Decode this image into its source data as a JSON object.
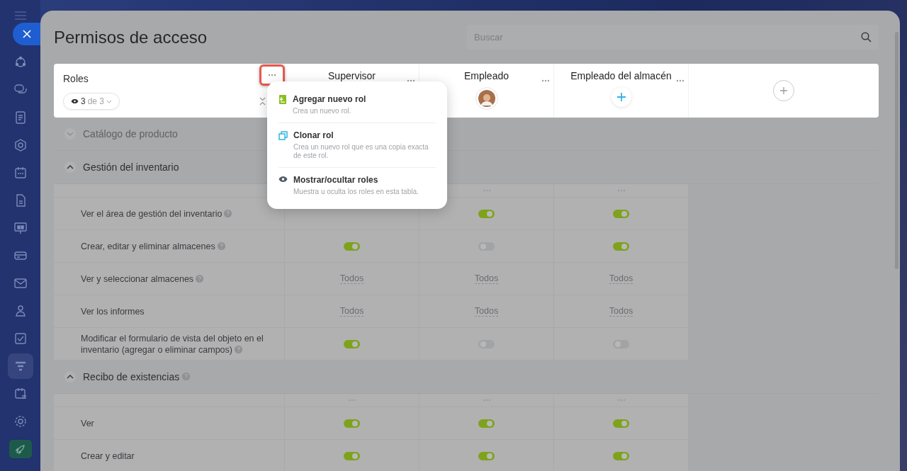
{
  "title": "Permisos de acceso",
  "search": {
    "placeholder": "Buscar"
  },
  "roles_header": {
    "label": "Roles",
    "filter_count": "3",
    "filter_total": "de 3",
    "menu_highlighted": true
  },
  "roles": [
    {
      "name": "Supervisor",
      "kind": "plain"
    },
    {
      "name": "Empleado",
      "kind": "avatar"
    },
    {
      "name": "Empleado del almacén",
      "kind": "add"
    }
  ],
  "menu": [
    {
      "kind": "add",
      "title": "Agregar nuevo rol",
      "description": "Crea un nuevo rol."
    },
    {
      "kind": "clone",
      "title": "Clonar rol",
      "description": "Crea un nuevo rol que es una copia exacta de este rol."
    },
    {
      "kind": "eye",
      "title": "Mostrar/ocultar roles",
      "description": "Muestra u oculta los roles en esta tabla."
    }
  ],
  "sections": [
    {
      "title": "Catálogo de producto",
      "expanded": false,
      "help": false
    },
    {
      "title": "Gestión del inventario",
      "expanded": true,
      "help": false,
      "menu_columns": [
        false,
        true,
        true
      ],
      "rows": [
        {
          "label": "Ver el área de gestión del inventario",
          "help": true,
          "cells": [
            {
              "kind": "covered"
            },
            {
              "kind": "toggle",
              "on": true
            },
            {
              "kind": "toggle",
              "on": true
            }
          ]
        },
        {
          "label": "Crear, editar y eliminar almacenes",
          "help": true,
          "cells": [
            {
              "kind": "toggle",
              "on": true
            },
            {
              "kind": "toggle",
              "on": false
            },
            {
              "kind": "toggle",
              "on": true
            }
          ]
        },
        {
          "label": "Ver y seleccionar almacenes",
          "help": true,
          "cells": [
            {
              "kind": "select",
              "value": "Todos"
            },
            {
              "kind": "select",
              "value": "Todos"
            },
            {
              "kind": "select",
              "value": "Todos"
            }
          ]
        },
        {
          "label": "Ver los informes",
          "help": false,
          "cells": [
            {
              "kind": "select",
              "value": "Todos"
            },
            {
              "kind": "select",
              "value": "Todos"
            },
            {
              "kind": "select",
              "value": "Todos"
            }
          ]
        },
        {
          "label": "Modificar el formulario de vista del objeto en el inventario (agregar o eliminar campos)",
          "help": true,
          "cells": [
            {
              "kind": "toggle",
              "on": true
            },
            {
              "kind": "toggle",
              "on": false
            },
            {
              "kind": "toggle",
              "on": false
            }
          ]
        }
      ]
    },
    {
      "title": "Recibo de existencias",
      "expanded": true,
      "help": true,
      "menu_columns": [
        true,
        true,
        true
      ],
      "rows": [
        {
          "label": "Ver",
          "help": false,
          "cells": [
            {
              "kind": "toggle",
              "on": true
            },
            {
              "kind": "toggle",
              "on": true
            },
            {
              "kind": "toggle",
              "on": true
            }
          ]
        },
        {
          "label": "Crear y editar",
          "help": false,
          "cells": [
            {
              "kind": "toggle",
              "on": true
            },
            {
              "kind": "toggle",
              "on": true
            },
            {
              "kind": "toggle",
              "on": true
            }
          ]
        }
      ]
    }
  ]
}
